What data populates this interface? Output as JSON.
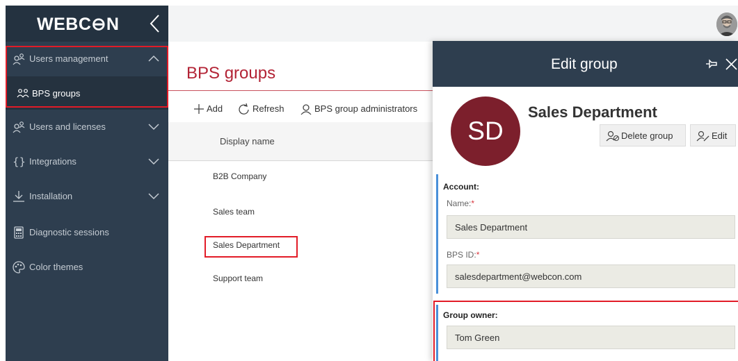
{
  "sidebar": {
    "logo": "WEBC⊖N",
    "items": [
      {
        "label": "Users management"
      },
      {
        "label": "BPS groups"
      },
      {
        "label": "Users and licenses"
      },
      {
        "label": "Integrations"
      },
      {
        "label": "Installation"
      },
      {
        "label": "Diagnostic sessions"
      },
      {
        "label": "Color themes"
      }
    ]
  },
  "main": {
    "title": "BPS groups",
    "toolbar": {
      "add": "Add",
      "refresh": "Refresh",
      "admins": "BPS group administrators"
    },
    "column_header": "Display name",
    "rows": [
      "B2B Company",
      "Sales team",
      "Sales Department",
      "Support team"
    ]
  },
  "panel": {
    "title": "Edit group",
    "initials": "SD",
    "group_name": "Sales Department",
    "delete_label": "Delete group",
    "edit_label": "Edit",
    "account": {
      "title": "Account:",
      "name_label": "Name:",
      "name_value": "Sales Department",
      "bpsid_label": "BPS ID:",
      "bpsid_value": "salesdepartment@webcon.com",
      "required_mark": "*"
    },
    "owner": {
      "title": "Group owner:",
      "value": "Tom Green"
    }
  },
  "colors": {
    "sidebar": "#2e3e4f",
    "accent_red": "#b32436",
    "avatar_bg": "#7c1f2c",
    "highlight": "#e21b27",
    "section_bar": "#4a90d9"
  }
}
